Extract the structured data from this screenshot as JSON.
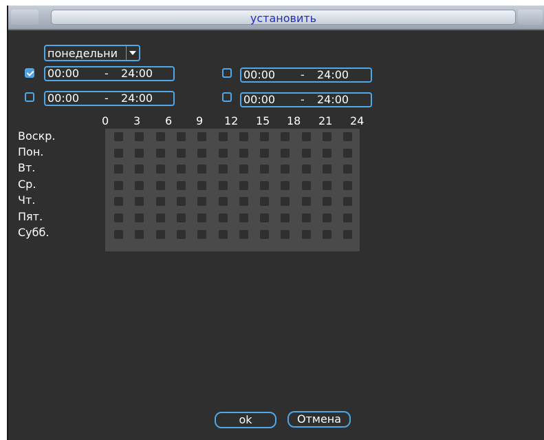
{
  "title": "установить",
  "day_select": {
    "value": "понедельни"
  },
  "periods": [
    {
      "checked": true,
      "start": "00:00",
      "sep": "-",
      "end": "24:00"
    },
    {
      "checked": false,
      "start": "00:00",
      "sep": "-",
      "end": "24:00"
    },
    {
      "checked": false,
      "start": "00:00",
      "sep": "-",
      "end": "24:00"
    },
    {
      "checked": false,
      "start": "00:00",
      "sep": "-",
      "end": "24:00"
    }
  ],
  "schedule": {
    "hours": [
      "0",
      "3",
      "6",
      "9",
      "12",
      "15",
      "18",
      "21",
      "24"
    ],
    "days": [
      "Воскр.",
      "Пон.",
      "Вт.",
      "Ср.",
      "Чт.",
      "Пят.",
      "Субб."
    ]
  },
  "buttons": {
    "ok": "ok",
    "cancel": "Отмена"
  },
  "colors": {
    "accent": "#4fa8e8",
    "title_text": "#1d2cc8",
    "background": "#2f2f2f"
  }
}
